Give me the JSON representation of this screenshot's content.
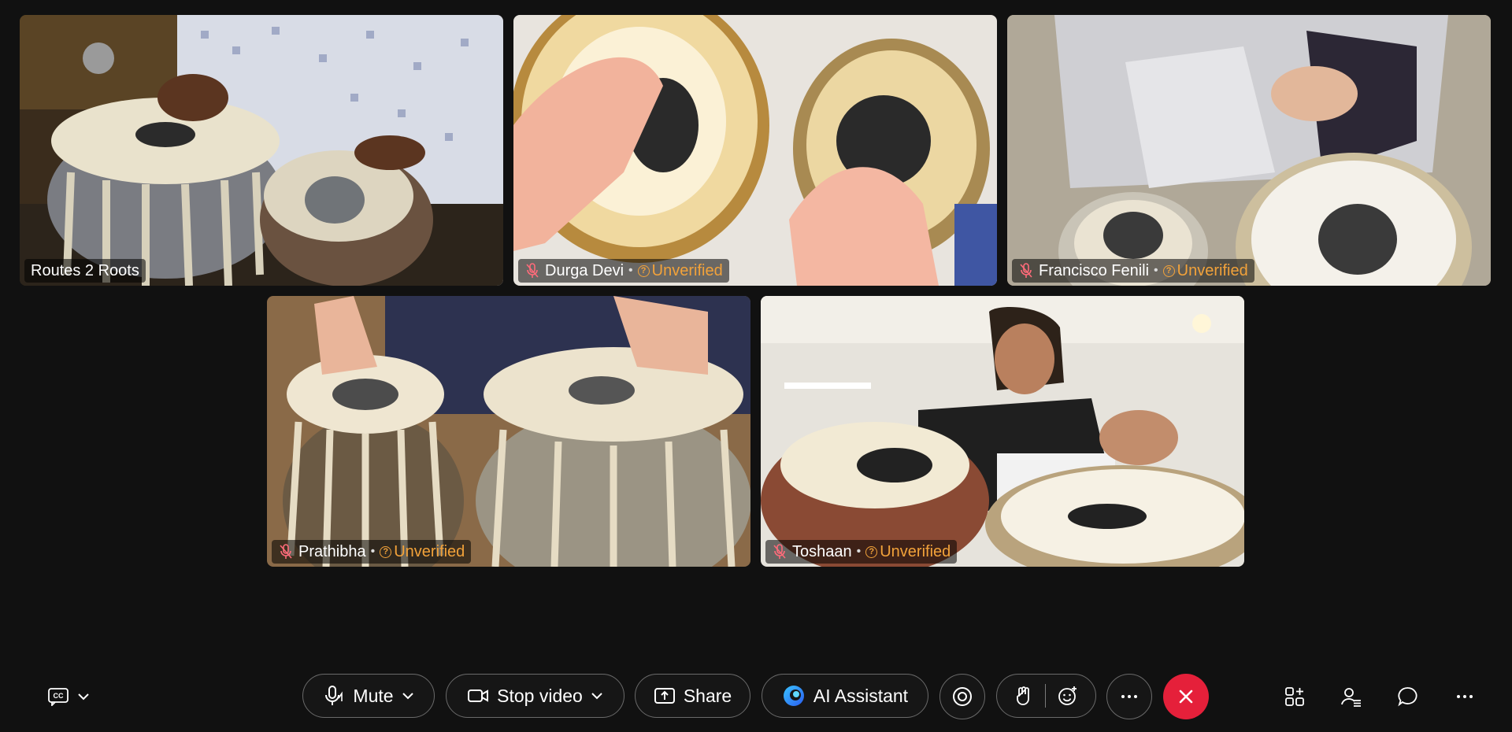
{
  "participants": [
    {
      "name": "Routes 2 Roots",
      "muted": false,
      "status": ""
    },
    {
      "name": "Durga Devi",
      "muted": true,
      "separator": "•",
      "status": "Unverified"
    },
    {
      "name": "Francisco Fenili",
      "muted": true,
      "separator": "•",
      "status": "Unverified"
    },
    {
      "name": "Prathibha",
      "muted": true,
      "separator": "•",
      "status": "Unverified"
    },
    {
      "name": "Toshaan",
      "muted": true,
      "separator": "•",
      "status": "Unverified"
    }
  ],
  "toolbar": {
    "captions_icon": "closed-captions-icon",
    "mute_label": "Mute",
    "stop_video_label": "Stop video",
    "share_label": "Share",
    "ai_assistant_label": "AI Assistant",
    "end_call_icon": "close-icon",
    "status_icon": "unverified-question-icon"
  },
  "colors": {
    "background": "#111111",
    "unverified": "#f2a23a",
    "end_call": "#e5203a",
    "button_border": "#6a6a6a"
  }
}
